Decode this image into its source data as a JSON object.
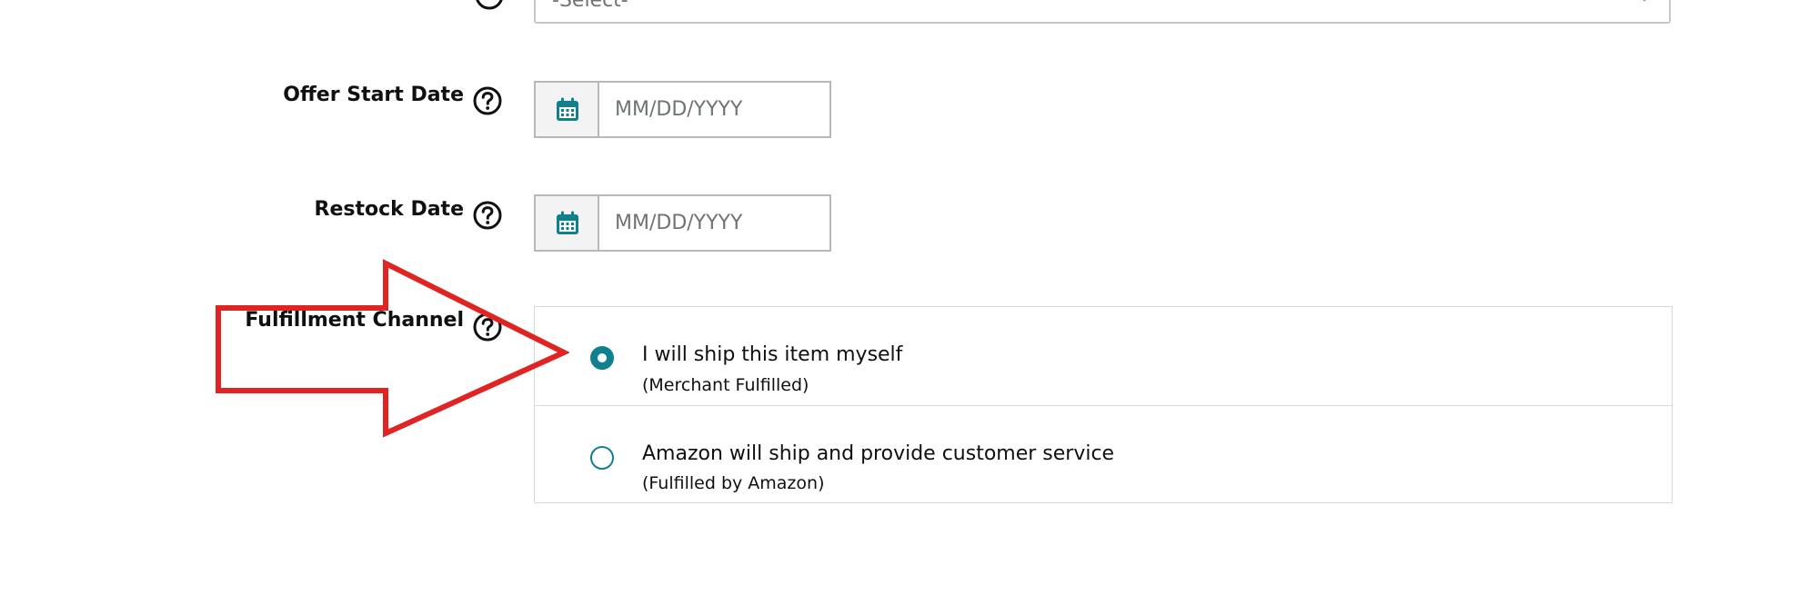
{
  "top_select": {
    "value": "-Select-",
    "icon": "chevron-down-icon"
  },
  "offer_start_date": {
    "label": "Offer Start Date",
    "placeholder": "MM/DD/YYYY",
    "icon": "calendar-icon"
  },
  "restock_date": {
    "label": "Restock Date",
    "placeholder": "MM/DD/YYYY",
    "icon": "calendar-icon"
  },
  "fulfillment_channel": {
    "label": "Fulfillment Channel",
    "options": [
      {
        "title": "I will ship this item myself",
        "subtitle": "(Merchant Fulfilled)",
        "selected": true
      },
      {
        "title": "Amazon will ship and provide customer service",
        "subtitle": "(Fulfilled by Amazon)",
        "selected": false
      }
    ]
  },
  "colors": {
    "accent_teal": "#10808f",
    "annotation_red": "#e02424",
    "border_gray": "#b8b8b8",
    "placeholder_gray": "#6f7373"
  },
  "annotation": {
    "icon": "red-arrow-annotation"
  }
}
